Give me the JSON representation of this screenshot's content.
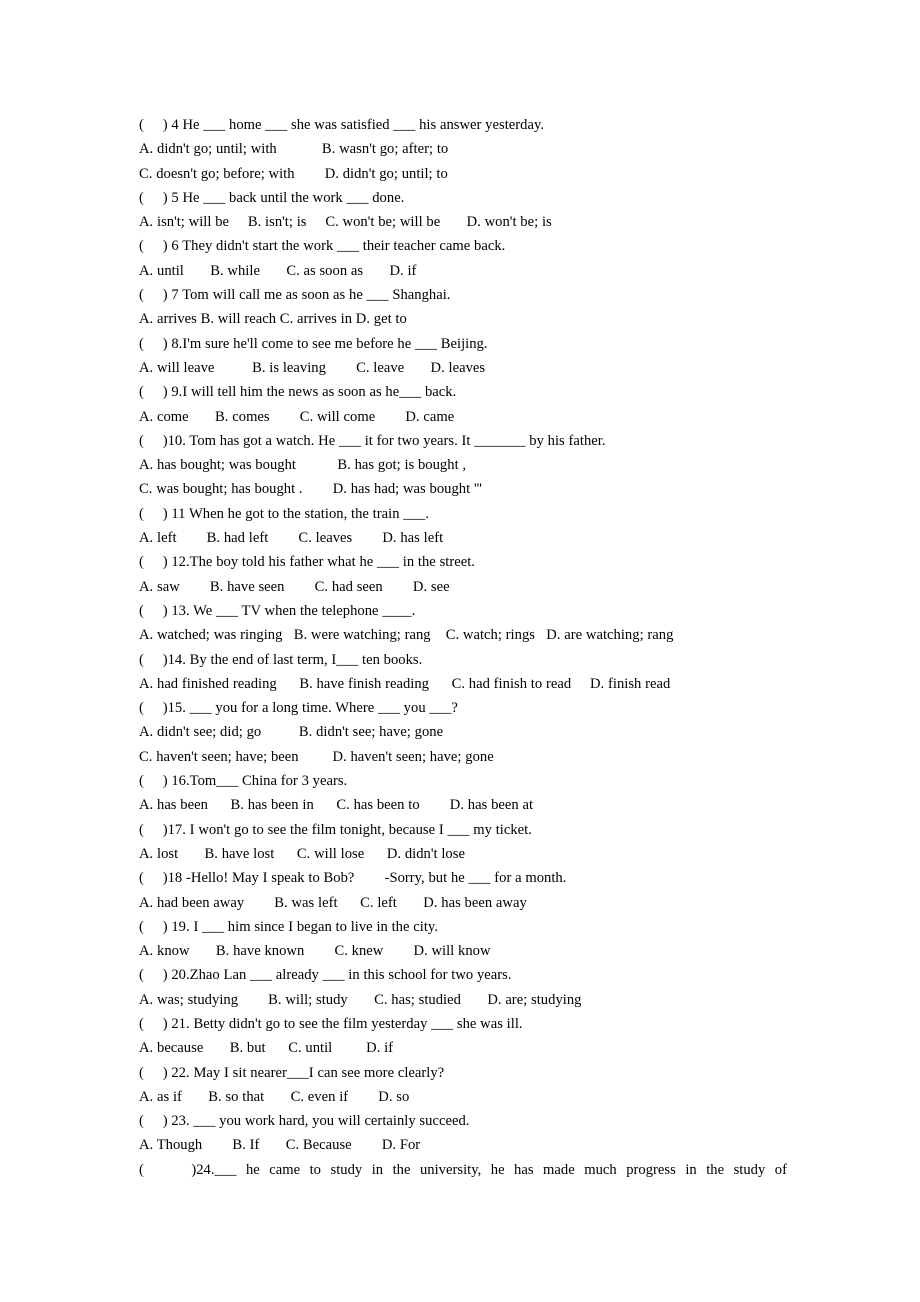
{
  "document": {
    "type": "english-grammar-multiple-choice-worksheet",
    "lines": [
      "(     ) 4 He ___ home ___ she was satisfied ___ his answer yesterday.",
      "A. didn't go; until; with            B. wasn't go; after; to",
      "C. doesn't go; before; with        D. didn't go; until; to",
      "(     ) 5 He ___ back until the work ___ done.",
      "A. isn't; will be     B. isn't; is     C. won't be; will be       D. won't be; is",
      "(     ) 6 They didn't start the work ___ their teacher came back.",
      "A. until       B. while       C. as soon as       D. if",
      "(     ) 7 Tom will call me as soon as he ___ Shanghai.",
      "A. arrives B. will reach C. arrives in D. get to",
      "(     ) 8.I'm sure he'll come to see me before he ___ Beijing.",
      "A. will leave          B. is leaving        C. leave       D. leaves",
      "(     ) 9.I will tell him the news as soon as he___ back.",
      "A. come       B. comes        C. will come        D. came",
      "(     )10. Tom has got a watch. He ___ it for two years. It _______ by his father.",
      "A. has bought; was bought           B. has got; is bought ,",
      "C. was bought; has bought .        D. has had; was bought '''",
      "(     ) 11 When he got to the station, the train ___.",
      "A. left        B. had left        C. leaves        D. has left",
      "(     ) 12.The boy told his father what he ___ in the street.",
      "A. saw        B. have seen        C. had seen        D. see",
      "(     ) 13. We ___ TV when the telephone ____.",
      "A. watched; was ringing   B. were watching; rang    C. watch; rings   D. are watching; rang",
      "(     )14. By the end of last term, I___ ten books.",
      "A. had finished reading      B. have finish reading      C. had finish to read     D. finish read",
      "(     )15. ___ you for a long time. Where ___ you ___?",
      "A. didn't see; did; go          B. didn't see; have; gone",
      "C. haven't seen; have; been         D. haven't seen; have; gone",
      "(     ) 16.Tom___ China for 3 years.",
      "A. has been      B. has been in      C. has been to        D. has been at",
      "(     )17. I won't go to see the film tonight, because I ___ my ticket.",
      "A. lost       B. have lost      C. will lose      D. didn't lose",
      "(     )18 -Hello! May I speak to Bob?        -Sorry, but he ___ for a month.",
      "A. had been away        B. was left      C. left       D. has been away",
      "(     ) 19. I ___ him since I began to live in the city.",
      "A. know       B. have known        C. knew        D. will know",
      "(     ) 20.Zhao Lan ___ already ___ in this school for two years.",
      "A. was; studying        B. will; study       C. has; studied       D. are; studying",
      "(     ) 21. Betty didn't go to see the film yesterday ___ she was ill.",
      "A. because       B. but      C. until         D. if",
      "(     ) 22. May I sit nearer___I can see more clearly?",
      "A. as if       B. so that       C. even if        D. so",
      "(     ) 23. ___ you work hard, you will certainly succeed.",
      "A. Though        B. If       C. Because        D. For"
    ],
    "last_line": "(     )24.___ he came to study in the university, he has made much progress in the study of"
  }
}
